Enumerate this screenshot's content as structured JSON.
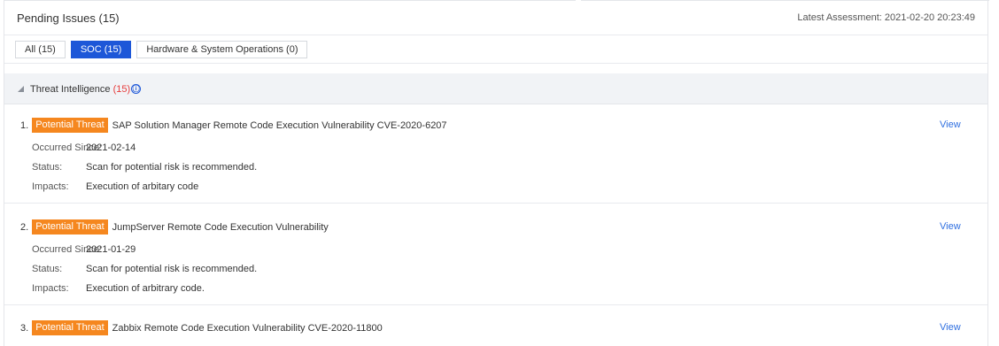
{
  "header": {
    "title": "Pending Issues (15)",
    "assessment": "Latest Assessment: 2021-02-20 20:23:49"
  },
  "tabs": [
    {
      "label": "All (15)",
      "active": false
    },
    {
      "label": "SOC (15)",
      "active": true
    },
    {
      "label": "Hardware & System Operations (0)",
      "active": false
    }
  ],
  "group": {
    "label": "Threat Intelligence",
    "count": "(15)",
    "info_icon": "ⓘ"
  },
  "labels": {
    "occurred": "Occurred Since:",
    "status": "Status:",
    "impacts": "Impacts:"
  },
  "items": [
    {
      "index": "1.",
      "badge": "Potential Threat",
      "title": "SAP Solution Manager Remote Code Execution Vulnerability CVE-2020-6207",
      "view": "View",
      "occurred": "2021-02-14",
      "status": "Scan for potential risk is recommended.",
      "impacts": "Execution of arbitary code"
    },
    {
      "index": "2.",
      "badge": "Potential Threat",
      "title": "JumpServer Remote Code Execution Vulnerability",
      "view": "View",
      "occurred": "2021-01-29",
      "status": "Scan for potential risk is recommended.",
      "impacts": "Execution of arbitrary code."
    },
    {
      "index": "3.",
      "badge": "Potential Threat",
      "title": "Zabbix Remote Code Execution Vulnerability CVE-2020-11800",
      "view": "View"
    }
  ],
  "colors": {
    "accent": "#1d57d8",
    "badge": "#f5871f",
    "link": "#2f6fe0",
    "count": "#e63c3c"
  }
}
